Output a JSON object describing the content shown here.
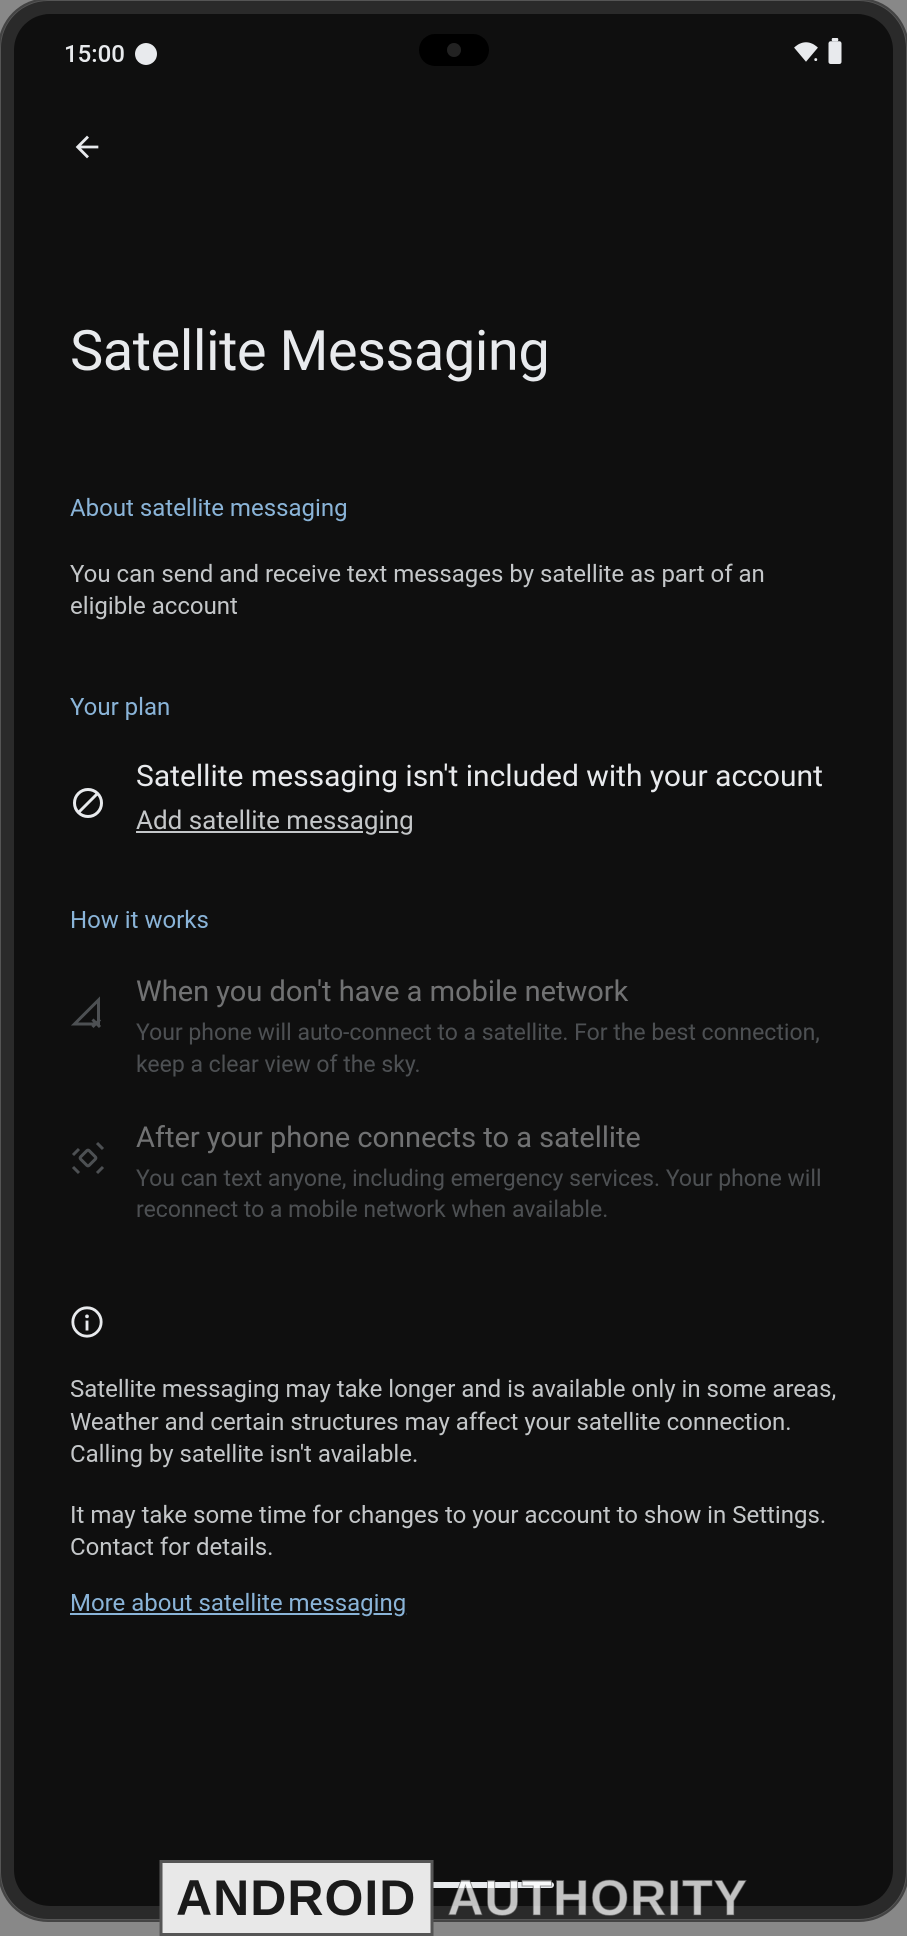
{
  "status_bar": {
    "time": "15:00"
  },
  "page": {
    "title": "Satellite Messaging"
  },
  "sections": {
    "about": {
      "header": "About satellite messaging",
      "body": "You can send and receive text messages by satellite as part of an eligible  account"
    },
    "plan": {
      "header": "Your  plan",
      "status_title": "Satellite messaging isn't included with your account",
      "add_link": "Add satellite messaging"
    },
    "how": {
      "header": "How it works",
      "items": [
        {
          "title": "When you don't have a mobile network",
          "desc": "Your phone will auto-connect to a satellite. For the best connection, keep a clear view of the sky."
        },
        {
          "title": "After your phone connects to a satellite",
          "desc": "You can text anyone, including emergency services. Your phone will reconnect to a mobile network when available."
        }
      ]
    }
  },
  "footer": {
    "para1": "Satellite messaging may take longer and is available only in some areas, Weather and certain structures may affect your satellite connection. Calling by satellite isn't available.",
    "para2": "It may take some time for changes to your account to show in Settings. Contact  for details.",
    "more_link": "More about satellite messaging"
  },
  "watermark": {
    "part1": "ANDROID",
    "part2": "AUTHORITY"
  }
}
